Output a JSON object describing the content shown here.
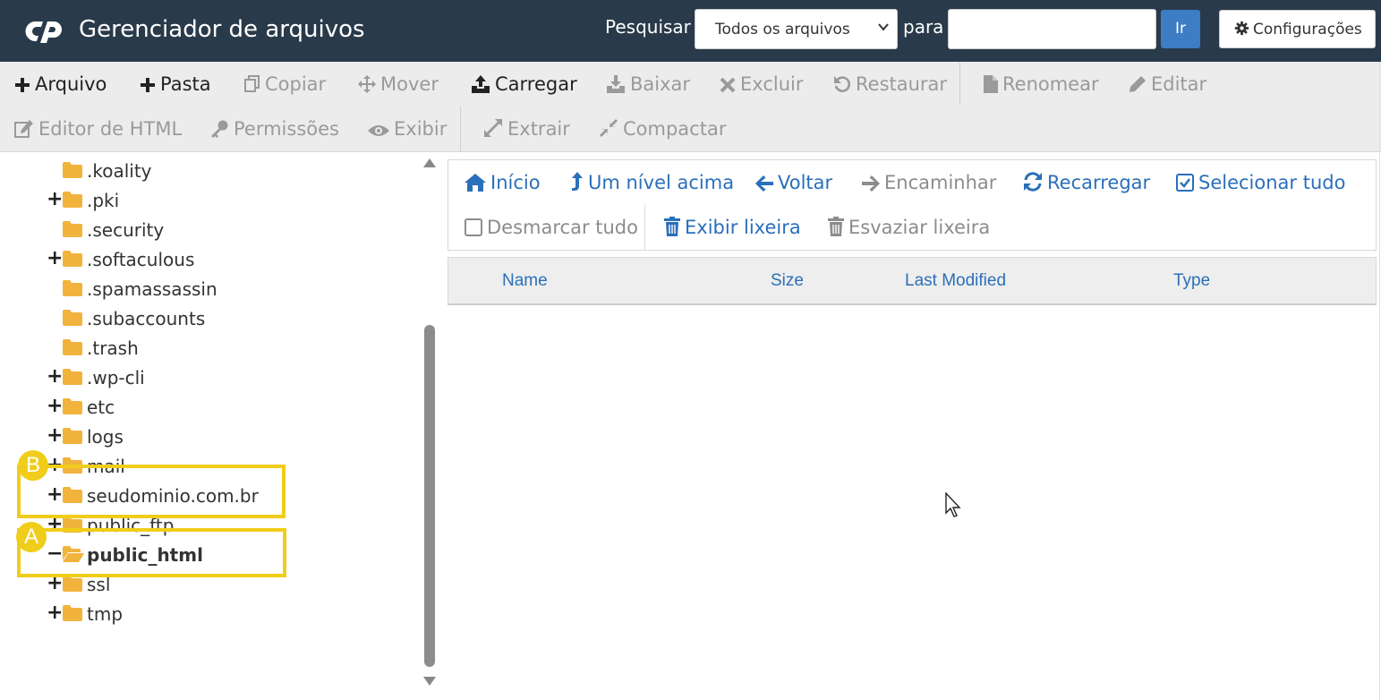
{
  "header": {
    "app_title": "Gerenciador de arquivos",
    "search_label": "Pesquisar",
    "search_scope": "Todos os arquivos",
    "para_label": "para",
    "search_value": "",
    "go_label": "Ir",
    "settings_label": "Configurações",
    "bg_color": "#293a4a",
    "accent_color": "#3c7dc4"
  },
  "toolbar": {
    "arquivo": "Arquivo",
    "pasta": "Pasta",
    "copiar": "Copiar",
    "mover": "Mover",
    "carregar": "Carregar",
    "baixar": "Baixar",
    "excluir": "Excluir",
    "restaurar": "Restaurar",
    "renomear": "Renomear",
    "editar": "Editar",
    "editor_html": "Editor de HTML",
    "permissoes": "Permissões",
    "exibir": "Exibir",
    "extrair": "Extrair",
    "compactar": "Compactar"
  },
  "tree": {
    "items": [
      {
        "label": ".koality",
        "expander": ""
      },
      {
        "label": ".pki",
        "expander": "+"
      },
      {
        "label": ".security",
        "expander": ""
      },
      {
        "label": ".softaculous",
        "expander": "+"
      },
      {
        "label": ".spamassassin",
        "expander": ""
      },
      {
        "label": ".subaccounts",
        "expander": ""
      },
      {
        "label": ".trash",
        "expander": ""
      },
      {
        "label": ".wp-cli",
        "expander": "+"
      },
      {
        "label": "etc",
        "expander": "+"
      },
      {
        "label": "logs",
        "expander": "+"
      },
      {
        "label": "mail",
        "expander": "+"
      },
      {
        "label": "seudominio.com.br",
        "expander": "+"
      },
      {
        "label": "public_ftp",
        "expander": "+"
      },
      {
        "label": "public_html",
        "expander": "−"
      },
      {
        "label": "ssl",
        "expander": "+"
      },
      {
        "label": "tmp",
        "expander": "+"
      }
    ],
    "folder_color": "#f2b33d"
  },
  "annotations": {
    "badge_a": "A",
    "badge_b": "B",
    "color": "#f0cd1a"
  },
  "nav": {
    "inicio": "Início",
    "um_nivel_acima": "Um nível acima",
    "voltar": "Voltar",
    "encaminhar": "Encaminhar",
    "recarregar": "Recarregar",
    "selecionar_tudo": "Selecionar tudo",
    "desmarcar_tudo": "Desmarcar tudo",
    "exibir_lixeira": "Exibir lixeira",
    "esvaziar_lixeira": "Esvaziar lixeira"
  },
  "table": {
    "columns": [
      "Name",
      "Size",
      "Last Modified",
      "Type"
    ]
  }
}
